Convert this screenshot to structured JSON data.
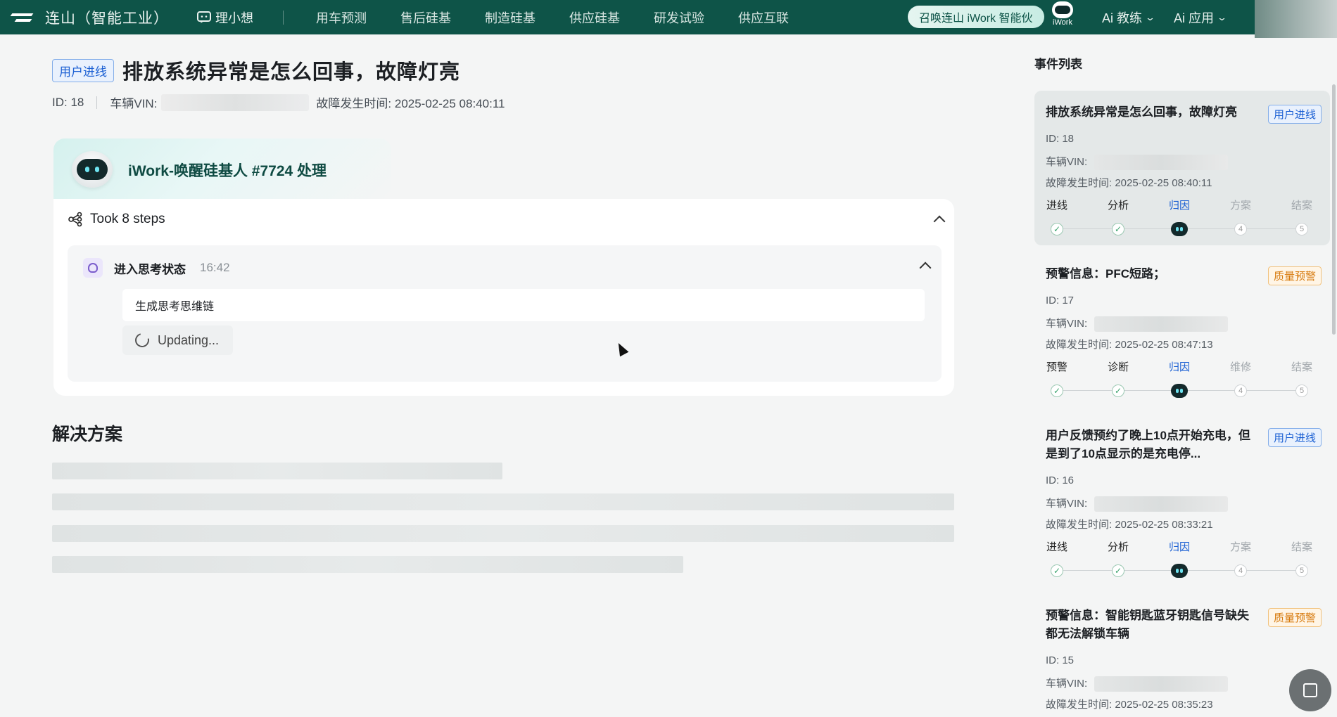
{
  "topbar": {
    "brand": "连山（智能工业）",
    "assistant": "理小想",
    "nav": [
      "用车预测",
      "售后硅基",
      "制造硅基",
      "供应硅基",
      "研发试验",
      "供应互联"
    ],
    "wake_button": "召唤连山 iWork 智能伙",
    "iwork_label": "iWork",
    "menu_coach": "Ai 教练",
    "menu_apps": "Ai 应用"
  },
  "detail": {
    "tag": "用户进线",
    "title": "排放系统异常是怎么回事，故障灯亮",
    "id_text": "ID: 18",
    "vin_label": "车辆VIN:",
    "time_text": "故障发生时间: 2025-02-25 08:40:11"
  },
  "agent": {
    "name": "iWork-唤醒硅基人 #7724 处理",
    "steps": "Took 8 steps",
    "think_title": "进入思考状态",
    "think_time": "16:42",
    "think_content": "生成思考思维链",
    "updating": "Updating..."
  },
  "solution": {
    "title": "解决方案"
  },
  "sidebar": {
    "title": "事件列表",
    "vin_label": "车辆VIN:",
    "events": [
      {
        "title": "排放系统异常是怎么回事，故障灯亮",
        "tag": "用户进线",
        "tag_color": "blue",
        "id": "ID: 18",
        "time": "故障发生时间: 2025-02-25 08:40:11",
        "stages": [
          "进线",
          "分析",
          "归因",
          "方案",
          "结案"
        ],
        "todo_nums": [
          "4",
          "5"
        ]
      },
      {
        "title": "预警信息：PFC短路；",
        "tag": "质量预警",
        "tag_color": "orange",
        "id": "ID: 17",
        "time": "故障发生时间: 2025-02-25 08:47:13",
        "stages": [
          "预警",
          "诊断",
          "归因",
          "维修",
          "结案"
        ],
        "todo_nums": [
          "4",
          "5"
        ]
      },
      {
        "title": "用户反馈预约了晚上10点开始充电，但是到了10点显示的是充电停...",
        "tag": "用户进线",
        "tag_color": "blue",
        "id": "ID: 16",
        "time": "故障发生时间: 2025-02-25 08:33:21",
        "stages": [
          "进线",
          "分析",
          "归因",
          "方案",
          "结案"
        ],
        "todo_nums": [
          "4",
          "5"
        ]
      },
      {
        "title": "预警信息：智能钥匙蓝牙钥匙信号缺失都无法解锁车辆",
        "tag": "质量预警",
        "tag_color": "orange",
        "id": "ID: 15",
        "time": "故障发生时间: 2025-02-25 08:35:23"
      }
    ]
  },
  "colors": {
    "topbar": "#0e5448",
    "accent_blue": "#1a5fd3",
    "accent_orange": "#d77a0d",
    "done_green": "#3aa36d"
  }
}
